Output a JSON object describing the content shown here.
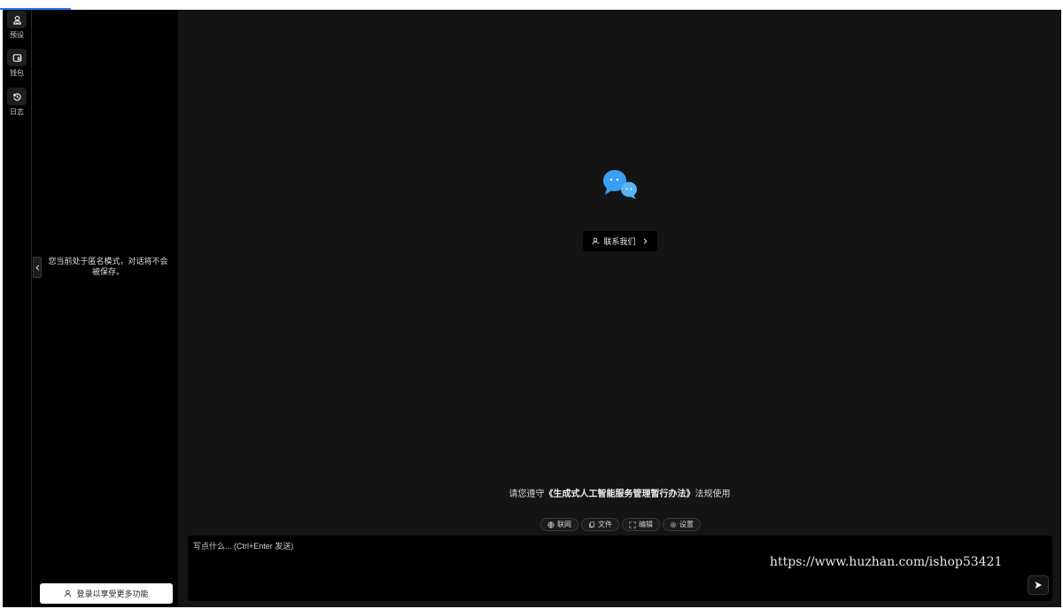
{
  "rail": {
    "items": [
      {
        "label": "预设",
        "icon": "user-preset-icon"
      },
      {
        "label": "钱包",
        "icon": "wallet-icon"
      },
      {
        "label": "日志",
        "icon": "history-icon"
      }
    ]
  },
  "sidebar": {
    "anonymous_notice": "您当前处于匿名模式，对话将不会被保存。",
    "login_label": "登录以享受更多功能"
  },
  "main": {
    "contact_label": "联系我们",
    "compliance_prefix": "请您遵守",
    "compliance_law": "《生成式人工智能服务管理暂行办法》",
    "compliance_suffix": "法规使用",
    "chips": [
      {
        "label": "联网",
        "icon": "globe-icon"
      },
      {
        "label": "文件",
        "icon": "file-icon"
      },
      {
        "label": "编辑",
        "icon": "expand-icon"
      },
      {
        "label": "设置",
        "icon": "gear-icon"
      }
    ],
    "input_placeholder": "写点什么... (Ctrl+Enter 发送)",
    "watermark": "https://www.huzhan.com/ishop53421"
  },
  "colors": {
    "accent": "#2f7bf6",
    "logo_blue": "#3aa0f5"
  }
}
